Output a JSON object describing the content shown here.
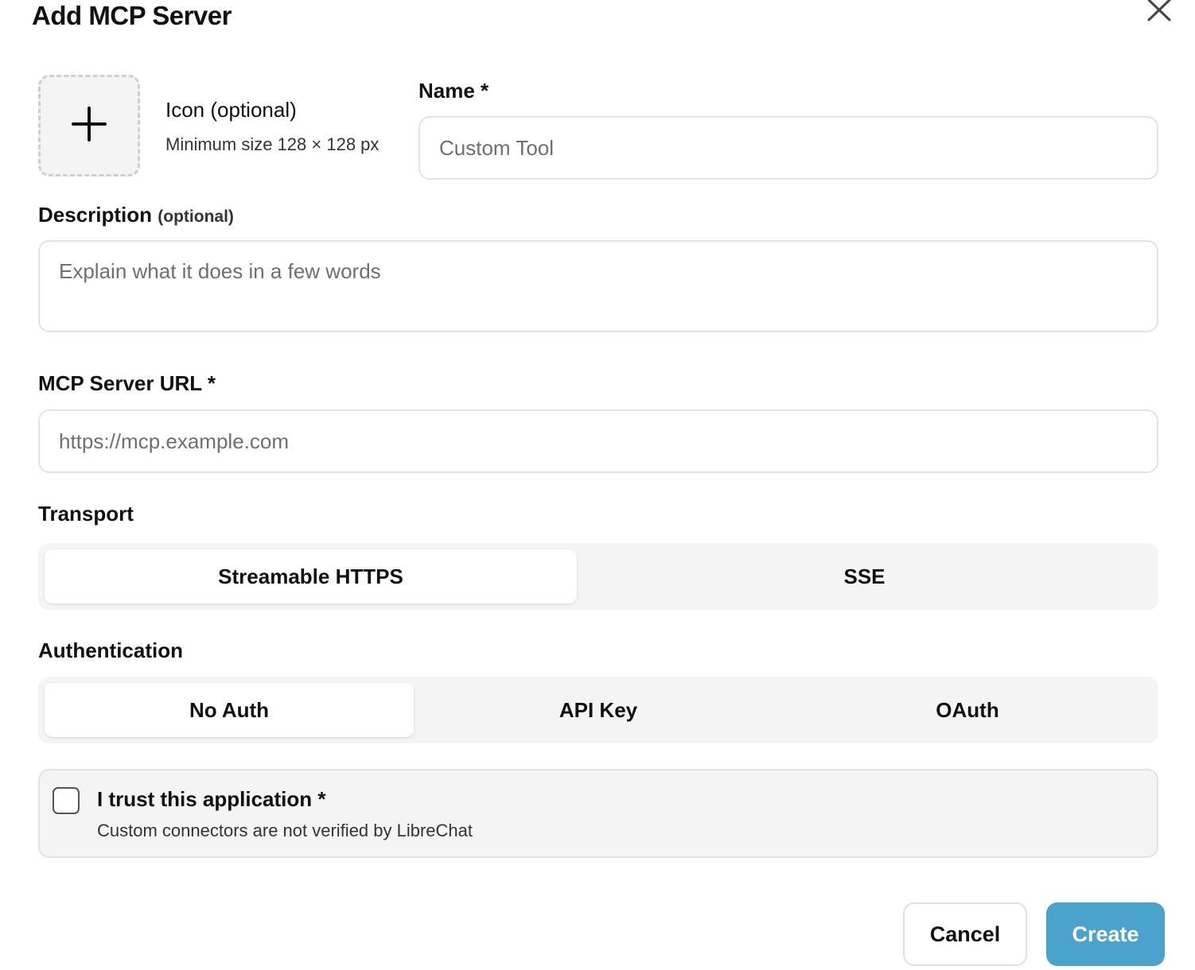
{
  "dialog": {
    "title": "Add MCP Server",
    "close_icon": "close-icon"
  },
  "icon_upload": {
    "icon": "plus-icon",
    "title": "Icon (optional)",
    "hint": "Minimum size 128 × 128 px"
  },
  "name": {
    "label": "Name *",
    "placeholder": "Custom Tool",
    "value": ""
  },
  "description": {
    "label": "Description",
    "optional_tag": "(optional)",
    "placeholder": "Explain what it does in a few words",
    "value": ""
  },
  "server_url": {
    "label": "MCP Server URL *",
    "placeholder": "https://mcp.example.com",
    "value": ""
  },
  "transport": {
    "label": "Transport",
    "options": [
      "Streamable HTTPS",
      "SSE"
    ],
    "selected": "Streamable HTTPS"
  },
  "authentication": {
    "label": "Authentication",
    "options": [
      "No Auth",
      "API Key",
      "OAuth"
    ],
    "selected": "No Auth"
  },
  "trust": {
    "title": "I trust this application *",
    "subtitle": "Custom connectors are not verified by LibreChat",
    "checked": false
  },
  "actions": {
    "cancel_label": "Cancel",
    "create_label": "Create"
  },
  "colors": {
    "primary_button": "#4aa3cc",
    "segment_bg": "#f4f4f4",
    "border": "#e3e3e3"
  }
}
